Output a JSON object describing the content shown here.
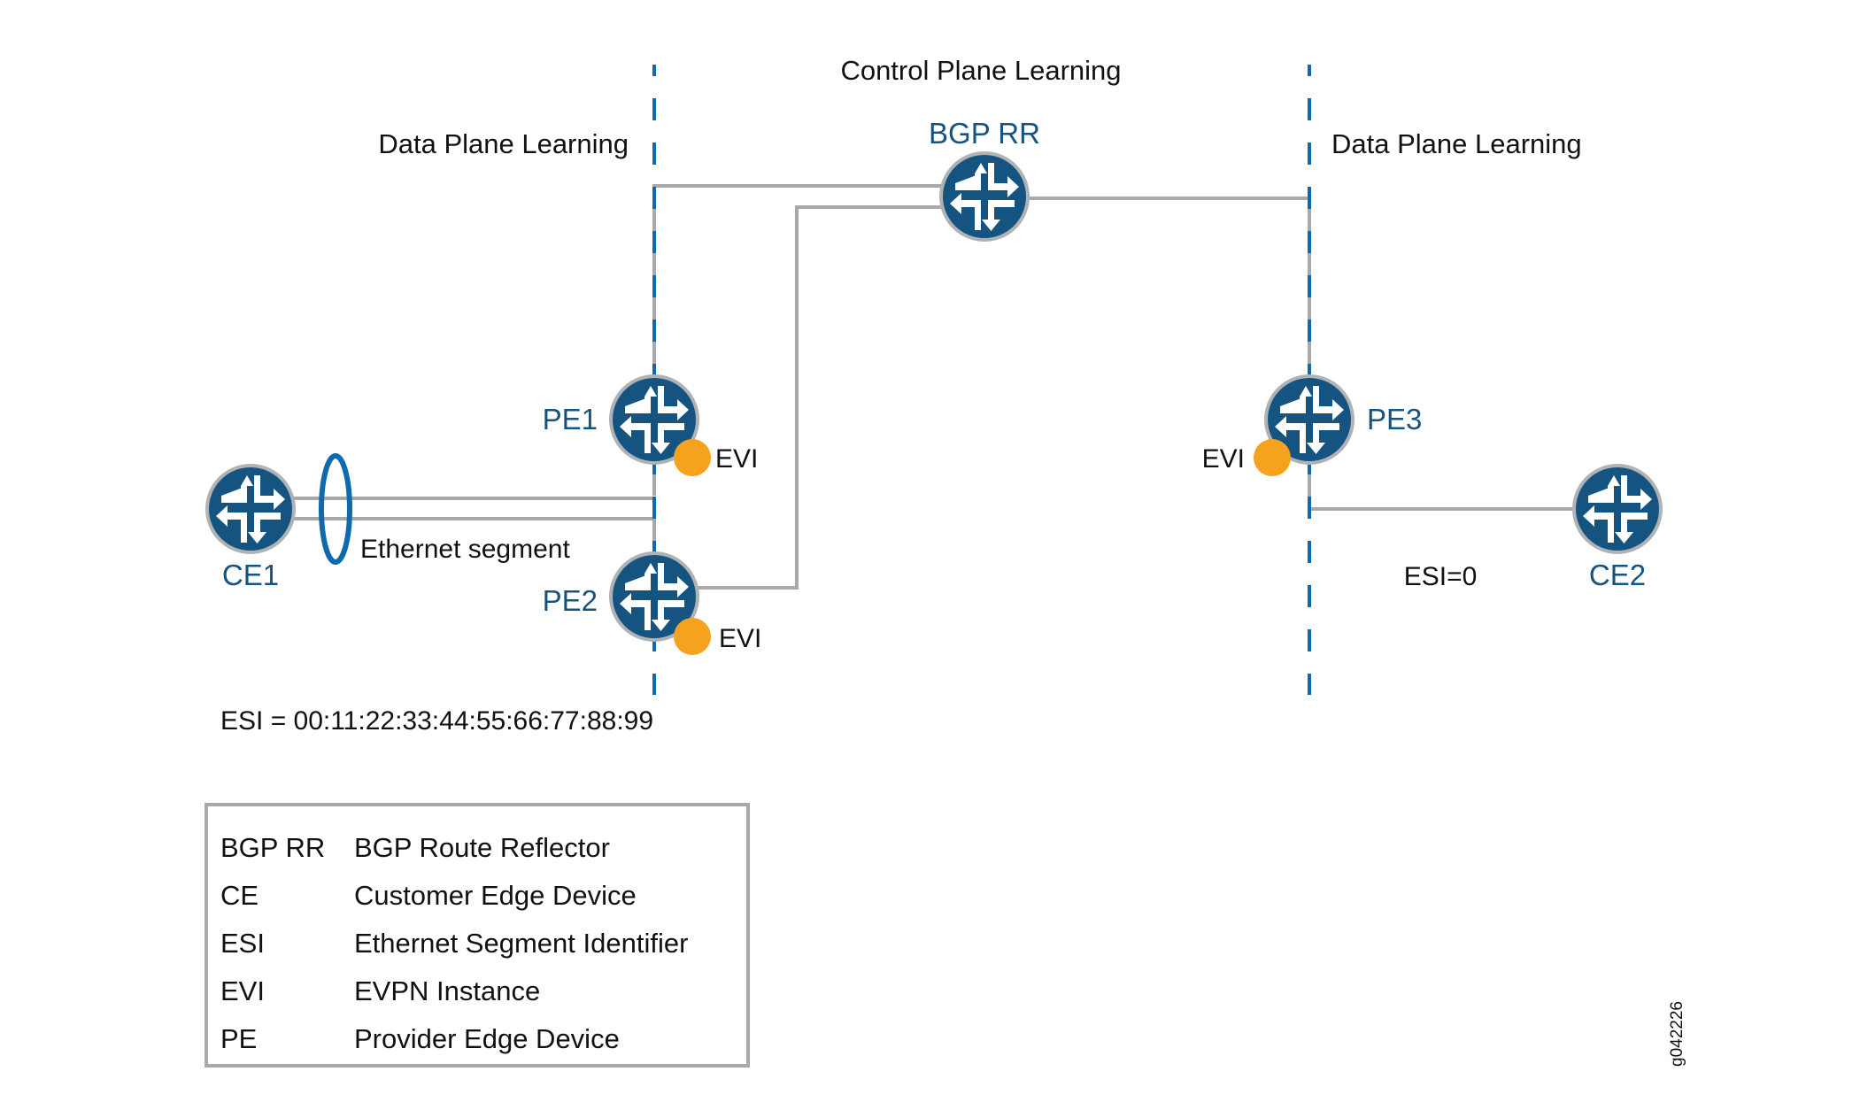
{
  "diagram": {
    "regions": {
      "left": "Data Plane Learning",
      "center": "Control Plane Learning",
      "right": "Data Plane Learning"
    },
    "devices": [
      {
        "id": "bgp-rr",
        "label": "BGP RR",
        "type": "route-reflector"
      },
      {
        "id": "pe1",
        "label": "PE1",
        "type": "provider-edge",
        "evi": "EVI"
      },
      {
        "id": "pe2",
        "label": "PE2",
        "type": "provider-edge",
        "evi": "EVI"
      },
      {
        "id": "pe3",
        "label": "PE3",
        "type": "provider-edge",
        "evi": "EVI"
      },
      {
        "id": "ce1",
        "label": "CE1",
        "type": "customer-edge"
      },
      {
        "id": "ce2",
        "label": "CE2",
        "type": "customer-edge"
      }
    ],
    "links": [
      {
        "from": "bgp-rr",
        "to": "pe1"
      },
      {
        "from": "bgp-rr",
        "to": "pe2"
      },
      {
        "from": "bgp-rr",
        "to": "pe3"
      },
      {
        "from": "ce1",
        "to": "pe1"
      },
      {
        "from": "ce1",
        "to": "pe2"
      },
      {
        "from": "pe3",
        "to": "ce2"
      }
    ],
    "ethernet_segment_label": "Ethernet segment",
    "esi_multihomed": "ESI = 00:11:22:33:44:55:66:77:88:99",
    "esi_single": "ESI=0",
    "figure_id": "g042226",
    "colors": {
      "device": "#155480",
      "device_border": "#b0b3b6",
      "evi": "#f5a31f",
      "divider": "#0f6aad",
      "link": "#a7a9ac"
    }
  },
  "legend": [
    {
      "abbr": "BGP RR",
      "meaning": "BGP Route Reflector"
    },
    {
      "abbr": "CE",
      "meaning": "Customer Edge Device"
    },
    {
      "abbr": "ESI",
      "meaning": "Ethernet Segment Identifier"
    },
    {
      "abbr": "EVI",
      "meaning": "EVPN Instance"
    },
    {
      "abbr": "PE",
      "meaning": "Provider Edge Device"
    }
  ]
}
